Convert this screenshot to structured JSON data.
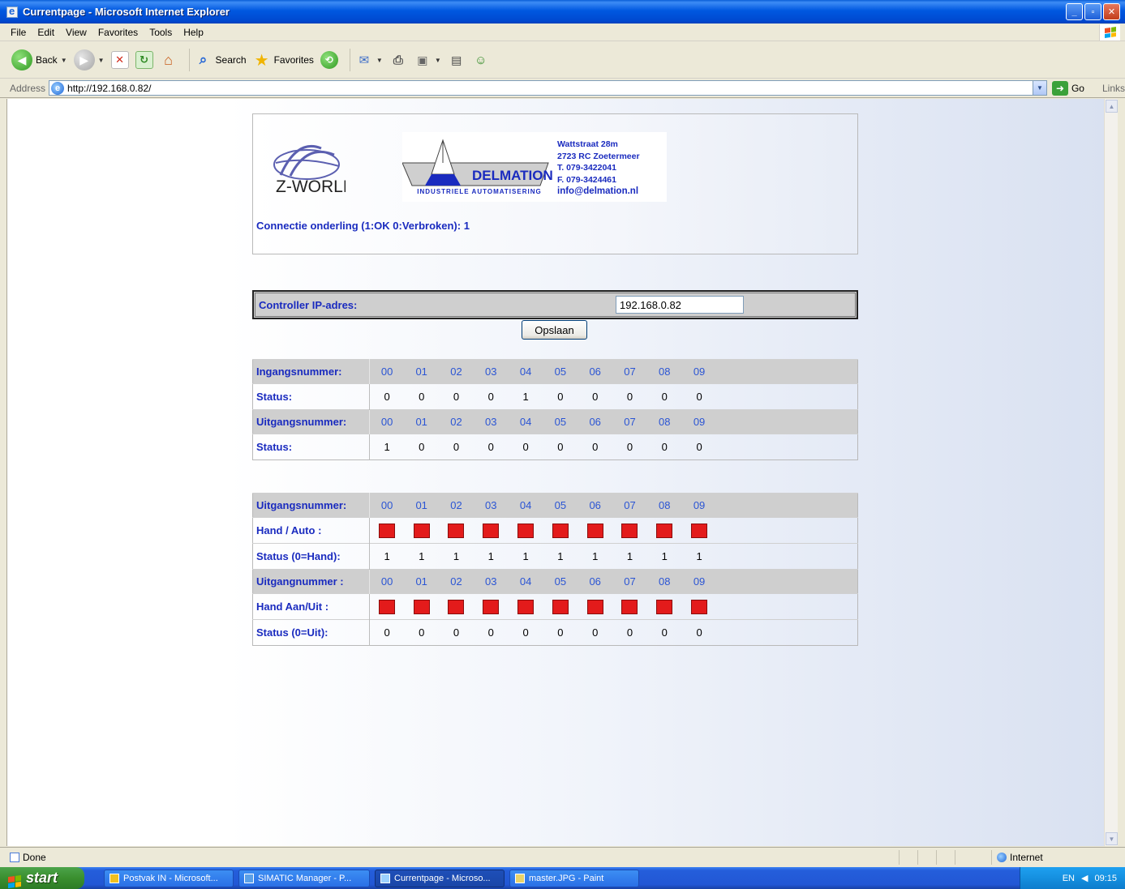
{
  "window": {
    "title": "Currentpage - Microsoft Internet Explorer"
  },
  "menu": [
    "File",
    "Edit",
    "View",
    "Favorites",
    "Tools",
    "Help"
  ],
  "toolbar": {
    "back": "Back",
    "search": "Search",
    "favorites": "Favorites"
  },
  "address": {
    "label": "Address",
    "url": "http://192.168.0.82/",
    "go": "Go",
    "links": "Links"
  },
  "header": {
    "brand_left": "Z-WORLD",
    "brand_right": "DELMATION",
    "brand_sub": "INDUSTRIELE AUTOMATISERING",
    "address_lines": [
      "Wattstraat 28m",
      "2723 RC  Zoetermeer",
      "T. 079-3422041",
      "F. 079-3424461",
      "info@delmation.nl"
    ],
    "connection": "Connectie onderling (1:OK 0:Verbroken): 1"
  },
  "ip": {
    "label": "Controller IP-adres:",
    "value": "192.168.0.82",
    "save": "Opslaan"
  },
  "io_table": {
    "rows": [
      {
        "label": "Ingangsnummer:",
        "header": true,
        "cells": [
          "00",
          "01",
          "02",
          "03",
          "04",
          "05",
          "06",
          "07",
          "08",
          "09"
        ]
      },
      {
        "label": "Status:",
        "header": false,
        "cells": [
          "0",
          "0",
          "0",
          "0",
          "1",
          "0",
          "0",
          "0",
          "0",
          "0"
        ]
      },
      {
        "label": "Uitgangsnummer:",
        "header": true,
        "cells": [
          "00",
          "01",
          "02",
          "03",
          "04",
          "05",
          "06",
          "07",
          "08",
          "09"
        ]
      },
      {
        "label": "Status:",
        "header": false,
        "cells": [
          "1",
          "0",
          "0",
          "0",
          "0",
          "0",
          "0",
          "0",
          "0",
          "0"
        ]
      }
    ]
  },
  "hand_table": {
    "rows": [
      {
        "label": "Uitgangsnummer:",
        "header": true,
        "cells": [
          "00",
          "01",
          "02",
          "03",
          "04",
          "05",
          "06",
          "07",
          "08",
          "09"
        ]
      },
      {
        "label": "Hand / Auto :",
        "header": false,
        "buttons": true,
        "button_color": "#e31b1b"
      },
      {
        "label": "Status (0=Hand):",
        "header": false,
        "cells": [
          "1",
          "1",
          "1",
          "1",
          "1",
          "1",
          "1",
          "1",
          "1",
          "1"
        ]
      },
      {
        "label": "Uitgangnummer :",
        "header": true,
        "cells": [
          "00",
          "01",
          "02",
          "03",
          "04",
          "05",
          "06",
          "07",
          "08",
          "09"
        ]
      },
      {
        "label": "Hand Aan/Uit :",
        "header": false,
        "buttons": true,
        "button_color": "#e31b1b"
      },
      {
        "label": "Status (0=Uit):",
        "header": false,
        "cells": [
          "0",
          "0",
          "0",
          "0",
          "0",
          "0",
          "0",
          "0",
          "0",
          "0"
        ]
      }
    ]
  },
  "status": {
    "left": "Done",
    "zone": "Internet"
  },
  "taskbar": {
    "start": "start",
    "tasks": [
      {
        "label": "Postvak IN - Microsoft...",
        "active": false
      },
      {
        "label": "SIMATIC Manager - P...",
        "active": false
      },
      {
        "label": "Currentpage - Microso...",
        "active": true
      },
      {
        "label": "master.JPG - Paint",
        "active": false
      }
    ],
    "lang": "EN",
    "clock": "09:15"
  },
  "colors": {
    "accent_text": "#1a2bbf",
    "header_number": "#2b55d4",
    "toggle_red": "#e31b1b",
    "titlebar": "#0058e0"
  }
}
